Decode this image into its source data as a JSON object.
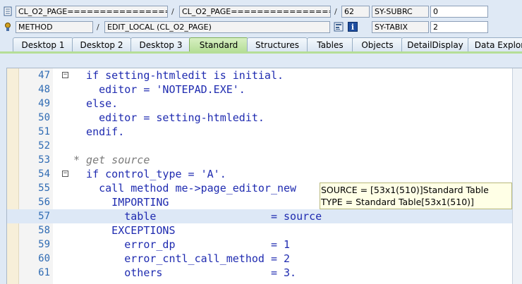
{
  "header": {
    "class_field": "CL_O2_PAGE====================",
    "class_field2": "CL_O2_PAGE====================",
    "line_number": "62",
    "sy_subrc_label": "SY-SUBRC",
    "sy_subrc_value": "0",
    "type_field": "METHOD",
    "method_field": "EDIT_LOCAL (CL_O2_PAGE)",
    "sy_tabix_label": "SY-TABIX",
    "sy_tabix_value": "2",
    "sep1": "/",
    "sep2": "/",
    "sep3": "/"
  },
  "tabs": [
    {
      "label": "Desktop 1"
    },
    {
      "label": "Desktop 2"
    },
    {
      "label": "Desktop 3"
    },
    {
      "label": "Standard",
      "active": true
    },
    {
      "label": "Structures"
    },
    {
      "label": "Tables"
    },
    {
      "label": "Objects"
    },
    {
      "label": "DetailDisplay"
    },
    {
      "label": "Data Explor"
    }
  ],
  "code": [
    {
      "n": "47",
      "t": "  if setting-htmledit is initial."
    },
    {
      "n": "48",
      "t": "    editor = 'NOTEPAD.EXE'."
    },
    {
      "n": "49",
      "t": "  else."
    },
    {
      "n": "50",
      "t": "    editor = setting-htmledit."
    },
    {
      "n": "51",
      "t": "  endif."
    },
    {
      "n": "52",
      "t": ""
    },
    {
      "n": "53",
      "t": "* get source"
    },
    {
      "n": "54",
      "t": "  if control_type = 'A'."
    },
    {
      "n": "55",
      "t": "    call method me->page_editor_new"
    },
    {
      "n": "56",
      "t": "      IMPORTING"
    },
    {
      "n": "57",
      "t": "        table                  = source"
    },
    {
      "n": "58",
      "t": "      EXCEPTIONS"
    },
    {
      "n": "59",
      "t": "        error_dp               = 1"
    },
    {
      "n": "60",
      "t": "        error_cntl_call_method = 2"
    },
    {
      "n": "61",
      "t": "        others                 = 3."
    }
  ],
  "tooltip": {
    "line1": "SOURCE = [53x1(510)]Standard Table",
    "line2": "TYPE  = Standard Table[53x1(510)]"
  }
}
